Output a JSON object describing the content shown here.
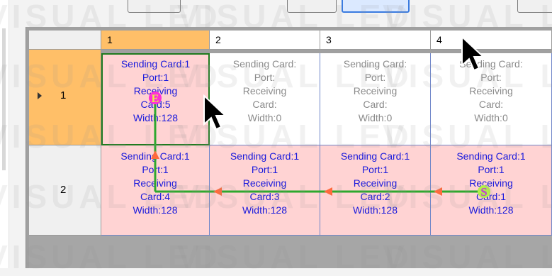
{
  "columns": [
    "1",
    "2",
    "3",
    "4"
  ],
  "rows": [
    {
      "label": "1",
      "cells": [
        {
          "lines": [
            "Sending Card:1",
            "Port:1",
            "Receiving",
            "Card:5",
            "Width:128"
          ],
          "state": "used"
        },
        {
          "lines": [
            "Sending Card:",
            "Port:",
            "Receiving",
            "Card:",
            "Width:0"
          ],
          "state": "empty"
        },
        {
          "lines": [
            "Sending Card:",
            "Port:",
            "Receiving",
            "Card:",
            "Width:0"
          ],
          "state": "empty"
        },
        {
          "lines": [
            "Sending Card:",
            "Port:",
            "Receiving",
            "Card:",
            "Width:0"
          ],
          "state": "empty"
        }
      ]
    },
    {
      "label": "2",
      "cells": [
        {
          "lines": [
            "Sending Card:1",
            "Port:1",
            "Receiving",
            "Card:4",
            "Width:128"
          ],
          "state": "used"
        },
        {
          "lines": [
            "Sending Card:1",
            "Port:1",
            "Receiving",
            "Card:3",
            "Width:128"
          ],
          "state": "used"
        },
        {
          "lines": [
            "Sending Card:1",
            "Port:1",
            "Receiving",
            "Card:2",
            "Width:128"
          ],
          "state": "used"
        },
        {
          "lines": [
            "Sending Card:1",
            "Port:1",
            "Receiving",
            "Card:1",
            "Width:128"
          ],
          "state": "used"
        }
      ]
    }
  ],
  "selection": {
    "row": 1,
    "column": 1
  },
  "route": {
    "start_label": "S",
    "end_label": "E",
    "line_color": "#2ea82e",
    "arrow_color": "#ff6a3d",
    "start_color": "#b4f04a",
    "end_color": "#ff2fd6"
  },
  "watermark": "VISUAL LED",
  "colors": {
    "used_cell_bg": "#ffd3d3",
    "used_cell_text": "#1a1adc",
    "empty_cell_text": "#8b8b8b",
    "selected_header_bg": "#ffbf68",
    "selected_border": "#1f7a1f"
  }
}
